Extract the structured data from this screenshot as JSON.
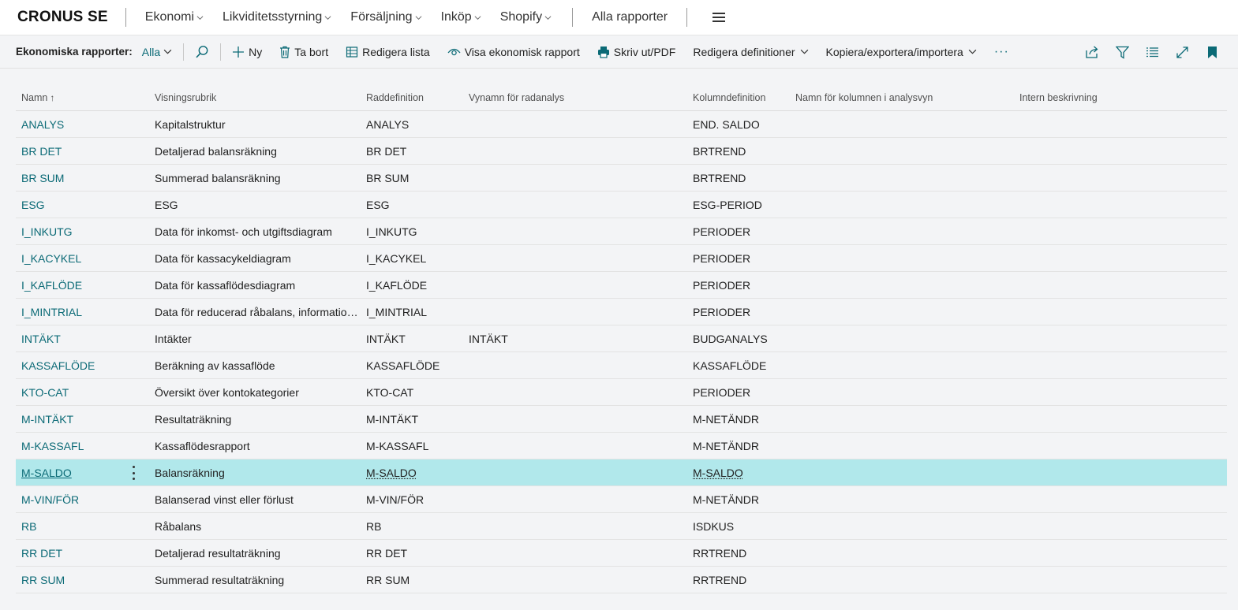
{
  "topbar": {
    "company": "CRONUS SE",
    "menus": [
      "Ekonomi",
      "Likviditetsstyrning",
      "Försäljning",
      "Inköp",
      "Shopify"
    ],
    "all_reports": "Alla rapporter"
  },
  "actionbar": {
    "label": "Ekonomiska rapporter:",
    "filter": "Alla",
    "new": "Ny",
    "delete": "Ta bort",
    "edit_list": "Redigera lista",
    "show_report": "Visa ekonomisk rapport",
    "print": "Skriv ut/PDF",
    "edit_defs": "Redigera definitioner",
    "copy_export": "Kopiera/exportera/importera",
    "more": "···"
  },
  "table": {
    "headers": [
      "Namn",
      "Visningsrubrik",
      "Raddefinition",
      "Vynamn för radanalys",
      "Kolumndefinition",
      "Namn för kolumnen i analysvyn",
      "Intern beskrivning"
    ],
    "sort_indicator": "↑",
    "rows": [
      [
        "ANALYS",
        "Kapitalstruktur",
        "ANALYS",
        "",
        "END. SALDO"
      ],
      [
        "BR DET",
        "Detaljerad balansräkning",
        "BR DET",
        "",
        "BRTREND"
      ],
      [
        "BR SUM",
        "Summerad balansräkning",
        "BR SUM",
        "",
        "BRTREND"
      ],
      [
        "ESG",
        "ESG",
        "ESG",
        "",
        "ESG-PERIOD"
      ],
      [
        "I_INKUTG",
        "Data för inkomst- och utgiftsdiagram",
        "I_INKUTG",
        "",
        "PERIODER"
      ],
      [
        "I_KACYKEL",
        "Data för kassacykeldiagram",
        "I_KACYKEL",
        "",
        "PERIODER"
      ],
      [
        "I_KAFLÖDE",
        "Data för kassaflödesdiagram",
        "I_KAFLÖDE",
        "",
        "PERIODER"
      ],
      [
        "I_MINTRIAL",
        "Data för reducerad råbalans, information...",
        "I_MINTRIAL",
        "",
        "PERIODER"
      ],
      [
        "INTÄKT",
        "Intäkter",
        "INTÄKT",
        "INTÄKT",
        "BUDGANALYS"
      ],
      [
        "KASSAFLÖDE",
        "Beräkning av kassaflöde",
        "KASSAFLÖDE",
        "",
        "KASSAFLÖDE"
      ],
      [
        "KTO-CAT",
        "Översikt över kontokategorier",
        "KTO-CAT",
        "",
        "PERIODER"
      ],
      [
        "M-INTÄKT",
        "Resultaträkning",
        "M-INTÄKT",
        "",
        "M-NETÄNDR"
      ],
      [
        "M-KASSAFL",
        "Kassaflödesrapport",
        "M-KASSAFL",
        "",
        "M-NETÄNDR"
      ],
      [
        "M-SALDO",
        "Balansräkning",
        "M-SALDO",
        "",
        "M-SALDO"
      ],
      [
        "M-VIN/FÖR",
        "Balanserad vinst eller förlust",
        "M-VIN/FÖR",
        "",
        "M-NETÄNDR"
      ],
      [
        "RB",
        "Råbalans",
        "RB",
        "",
        "ISDKUS"
      ],
      [
        "RR DET",
        "Detaljerad resultaträkning",
        "RR DET",
        "",
        "RRTREND"
      ],
      [
        "RR SUM",
        "Summerad resultaträkning",
        "RR SUM",
        "",
        "RRTREND"
      ]
    ],
    "selected_index": 13
  },
  "colors": {
    "accent": "#0b6a76",
    "selected_row": "#b1e8eb"
  }
}
